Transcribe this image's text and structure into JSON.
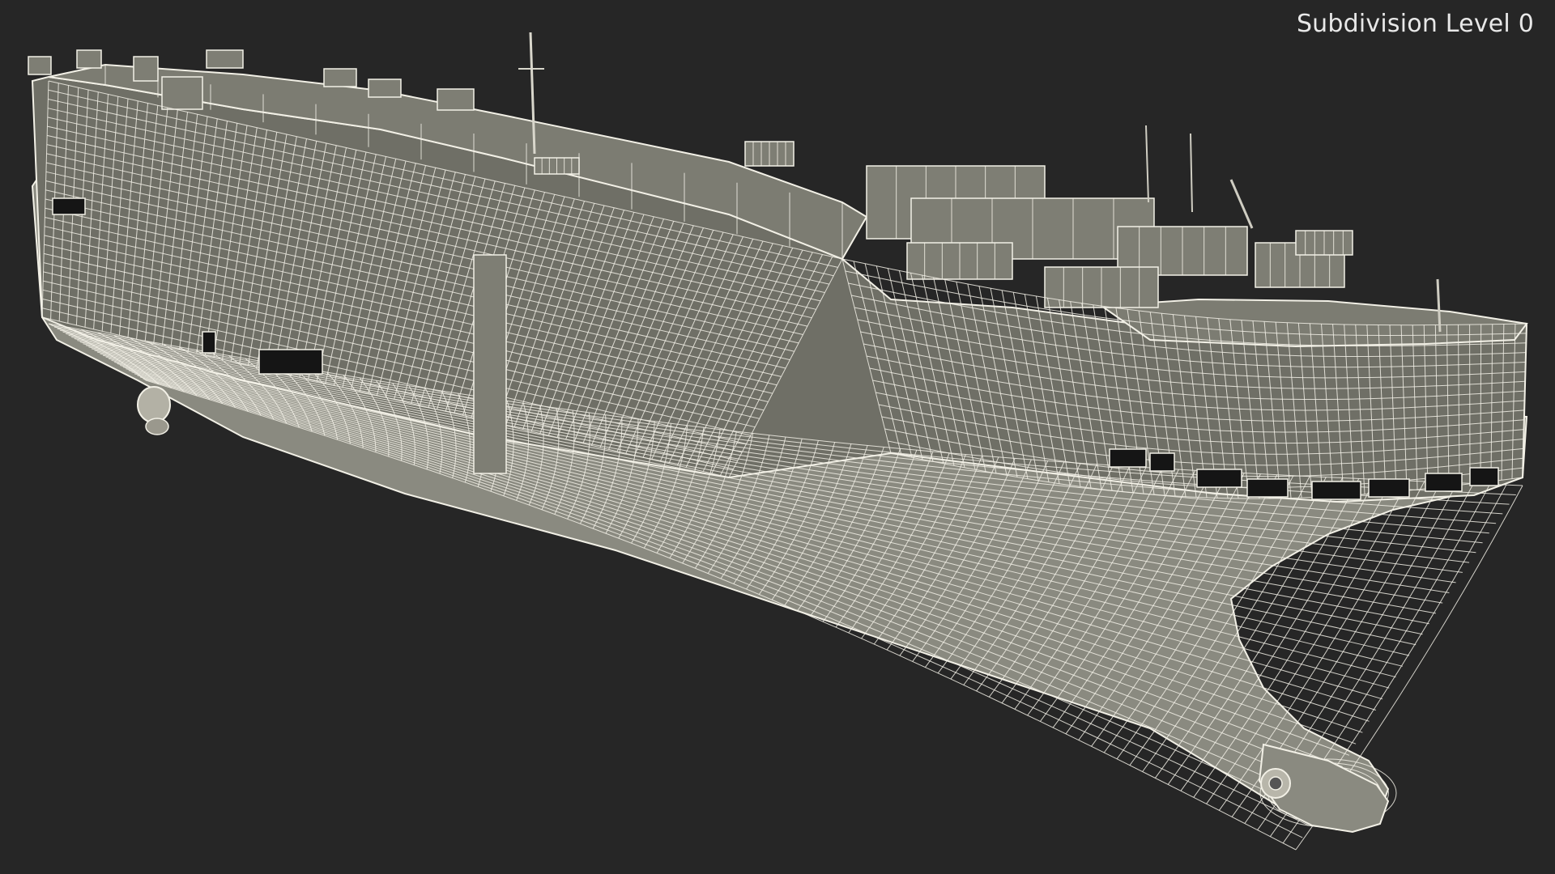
{
  "viewport": {
    "overlay_label": "Subdivision Level 0"
  },
  "model": {
    "subject": "ship-hull-wireframe"
  },
  "colors": {
    "background": "#262626",
    "hull_fill": "#8a8a80",
    "hull_fill_dark": "#6f6f66",
    "deck_fill": "#7c7c72",
    "wire": "#f2f0e6",
    "window": "#151515"
  }
}
